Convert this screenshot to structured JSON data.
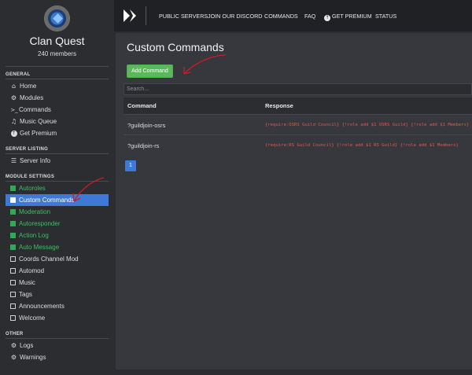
{
  "server": {
    "name": "Clan Quest",
    "members": "240 members"
  },
  "sidebar": {
    "sections": [
      {
        "heading": "GENERAL",
        "items": [
          {
            "label": "Home",
            "icon": "home-icon"
          },
          {
            "label": "Modules",
            "icon": "modules-icon"
          },
          {
            "label": "Commands",
            "icon": "terminal-icon"
          },
          {
            "label": "Music Queue",
            "icon": "music-icon"
          },
          {
            "label": "Get Premium",
            "icon": "premium-icon"
          }
        ]
      },
      {
        "heading": "SERVER LISTING",
        "items": [
          {
            "label": "Server Info",
            "icon": "list-icon"
          }
        ]
      },
      {
        "heading": "MODULE SETTINGS",
        "items": [
          {
            "label": "Autoroles",
            "enabled": true
          },
          {
            "label": "Custom Commands",
            "active": true
          },
          {
            "label": "Moderation",
            "enabled": true
          },
          {
            "label": "Autoresponder",
            "enabled": true
          },
          {
            "label": "Action Log",
            "enabled": true
          },
          {
            "label": "Auto Message",
            "enabled": true
          },
          {
            "label": "Coords Channel Mod"
          },
          {
            "label": "Automod"
          },
          {
            "label": "Music"
          },
          {
            "label": "Tags"
          },
          {
            "label": "Announcements"
          },
          {
            "label": "Welcome"
          }
        ]
      },
      {
        "heading": "OTHER",
        "items": [
          {
            "label": "Logs",
            "icon": "cogs-icon"
          },
          {
            "label": "Warnings",
            "icon": "cogs-icon"
          }
        ]
      }
    ]
  },
  "topnav": {
    "links": [
      "PUBLIC SERVERS",
      "JOIN OUR DISCORD",
      "COMMANDS",
      "FAQ",
      "GET PREMIUM",
      "STATUS"
    ]
  },
  "main": {
    "title": "Custom Commands",
    "add_button": "Add Command",
    "search_placeholder": "Search...",
    "table": {
      "headers": [
        "Command",
        "Response"
      ],
      "rows": [
        {
          "command": "?guildjoin-osrs",
          "response": "{require:OSRS Guild Council} {!role add $1 OSRS Guild} {!role add $1 Members}"
        },
        {
          "command": "?guildjoin-rs",
          "response": "{require:RS Guild Council} {!role add $1 RS Guild} {!role add $1 Members}"
        }
      ]
    },
    "pagination": {
      "current_page": "1"
    }
  },
  "colors": {
    "accent": "#3e79d8",
    "enabled_green": "#3fbf5f",
    "button_green": "#5cb85c",
    "response_red": "#e4574b",
    "annotation_arrow": "#c81e24"
  }
}
